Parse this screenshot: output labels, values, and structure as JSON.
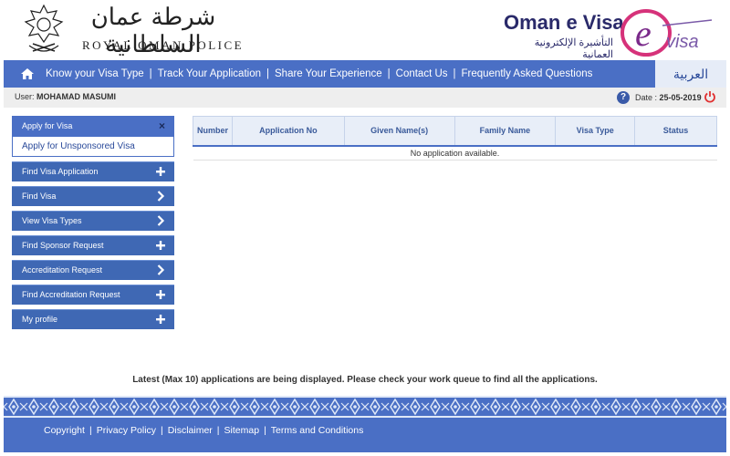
{
  "header": {
    "rop_arabic": "شرطة عمان السلطانية",
    "rop_english": "ROYAL OMAN POLICE",
    "evisa_title": "Oman e Visa",
    "evisa_arabic": "التأشيرة الإلكترونية العمانية"
  },
  "nav": {
    "links": [
      "Know your Visa Type",
      "Track Your Application",
      "Share Your Experience",
      "Contact Us",
      "Frequently Asked Questions"
    ],
    "language": "العربية"
  },
  "userbar": {
    "user_label": "User:",
    "user_name": "MOHAMAD MASUMI",
    "date_label": "Date :",
    "date_value": "25-05-2019"
  },
  "sidebar": {
    "apply_header": "Apply for Visa",
    "apply_close": "×",
    "apply_sub": "Apply for Unsponsored Visa",
    "items": [
      {
        "label": "Find Visa Application",
        "icon": "plus"
      },
      {
        "label": "Find Visa",
        "icon": "chevron-right"
      },
      {
        "label": "View Visa Types",
        "icon": "chevron-right"
      },
      {
        "label": "Find Sponsor Request",
        "icon": "plus"
      },
      {
        "label": "Accreditation Request",
        "icon": "chevron-right"
      },
      {
        "label": "Find Accreditation Request",
        "icon": "plus"
      },
      {
        "label": "My profile",
        "icon": "plus"
      }
    ]
  },
  "table": {
    "columns": [
      "Number",
      "Application No",
      "Given Name(s)",
      "Family Name",
      "Visa Type",
      "Status"
    ],
    "empty_message": "No application available."
  },
  "notice": "Latest (Max 10) applications are being displayed. Please check your work queue to find all the applications.",
  "footer": {
    "links": [
      "Copyright",
      "Privacy Policy",
      "Disclaimer",
      "Sitemap",
      "Terms and Conditions"
    ]
  },
  "colors": {
    "primary": "#4a6fc5",
    "sidebar_item": "#3f68b4",
    "power": "#e03030"
  }
}
